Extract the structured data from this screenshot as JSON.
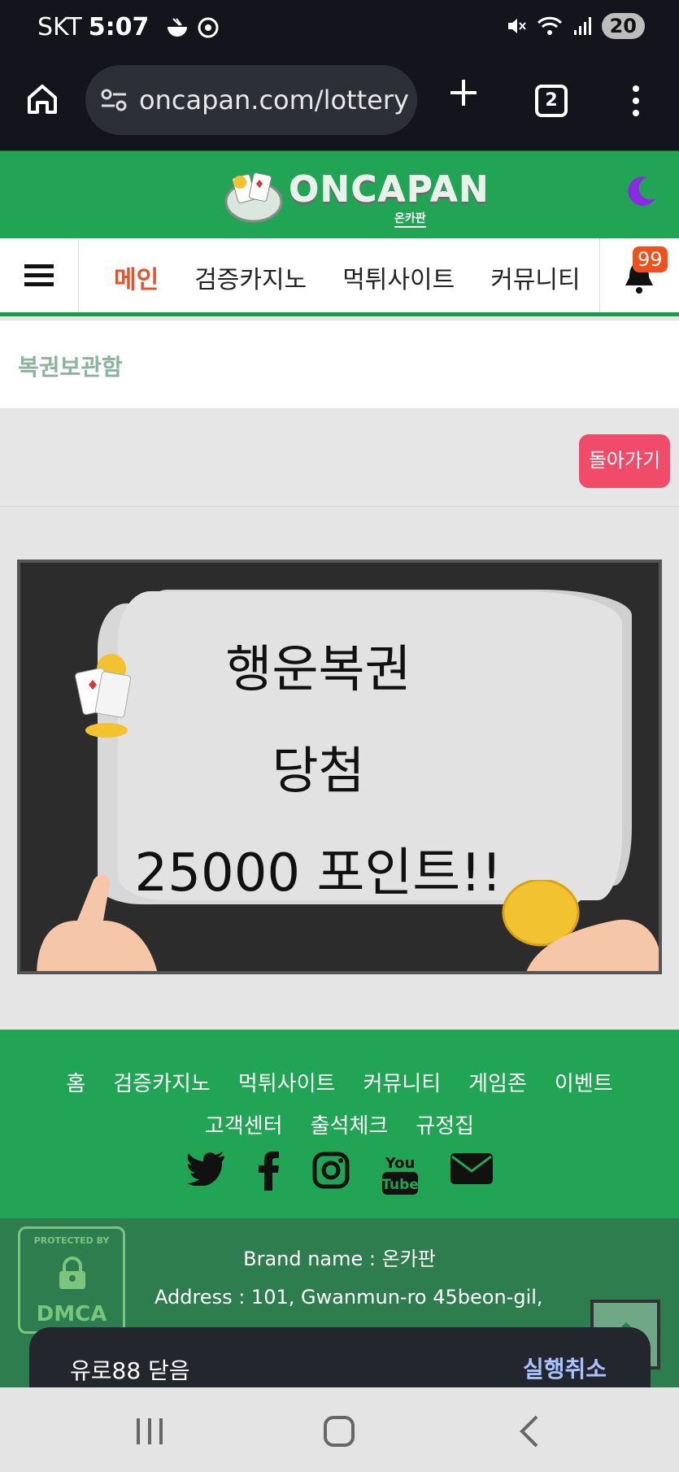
{
  "status_bar": {
    "carrier": "SKT",
    "time": "5:07",
    "battery": "20",
    "icons": [
      "noodle-icon",
      "chrome-icon",
      "mute-icon",
      "wifi-icon",
      "signal-icon"
    ]
  },
  "browser": {
    "url": "oncapan.com/lottery",
    "tab_count": "2",
    "icons": [
      "home-icon",
      "site-settings-icon",
      "new-tab-icon",
      "menu-icon"
    ]
  },
  "site": {
    "logo_text": "ONCAPAN",
    "logo_sub": "온카판",
    "nav": {
      "items": [
        "메인",
        "검증카지노",
        "먹튀사이트",
        "커뮤니티"
      ],
      "notification_count": "99"
    },
    "breadcrumb": "복권보관함",
    "back_button": "돌아가기"
  },
  "ticket": {
    "line1": "행운복권",
    "line2": "당첨",
    "line3": "25000 포인트!!"
  },
  "footer": {
    "links_row1": [
      "홈",
      "검증카지노",
      "먹튀사이트",
      "커뮤니티",
      "게임존",
      "이벤트"
    ],
    "links_row2": [
      "고객센터",
      "출석체크",
      "규정집"
    ],
    "social": [
      "twitter-icon",
      "facebook-icon",
      "instagram-icon",
      "youtube-icon",
      "mail-icon"
    ],
    "youtube_top": "You",
    "youtube_bottom": "Tube",
    "dmca_top": "PROTECTED BY",
    "dmca_bottom": "DMCA",
    "brand": "Brand name : 온카판",
    "address": "Address : 101, Gwanmun-ro 45beon-gil,"
  },
  "toast": {
    "message": "유로88 닫음",
    "action": "실행취소"
  },
  "colors": {
    "green": "#22a455",
    "accent_red": "#e8512a",
    "back_button": "#f14b6a"
  }
}
